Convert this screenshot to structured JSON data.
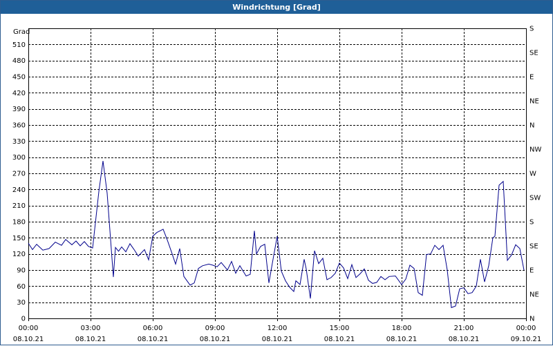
{
  "window": {
    "title": "Windrichtung [Grad]"
  },
  "chart_data": {
    "type": "line",
    "title": "Windrichtung [Grad]",
    "ylabel": "Grad",
    "ylim": [
      0,
      540
    ],
    "y_ticks": [
      0,
      30,
      60,
      90,
      120,
      150,
      180,
      210,
      240,
      270,
      300,
      330,
      360,
      390,
      420,
      450,
      480,
      510
    ],
    "y2_ticks": [
      {
        "value": 0,
        "label": "N"
      },
      {
        "value": 45,
        "label": "NE"
      },
      {
        "value": 90,
        "label": "E"
      },
      {
        "value": 135,
        "label": "SE"
      },
      {
        "value": 180,
        "label": "S"
      },
      {
        "value": 225,
        "label": "SW"
      },
      {
        "value": 270,
        "label": "W"
      },
      {
        "value": 315,
        "label": "NW"
      },
      {
        "value": 360,
        "label": "N"
      },
      {
        "value": 405,
        "label": "NE"
      },
      {
        "value": 450,
        "label": "E"
      },
      {
        "value": 495,
        "label": "SE"
      },
      {
        "value": 540,
        "label": "S"
      }
    ],
    "xlim_hours": [
      0,
      24
    ],
    "x_ticks": [
      {
        "hour": 0,
        "time": "00:00",
        "date": "08.10.21"
      },
      {
        "hour": 3,
        "time": "03:00",
        "date": "08.10.21"
      },
      {
        "hour": 6,
        "time": "06:00",
        "date": "08.10.21"
      },
      {
        "hour": 9,
        "time": "09:00",
        "date": "08.10.21"
      },
      {
        "hour": 12,
        "time": "12:00",
        "date": "08.10.21"
      },
      {
        "hour": 15,
        "time": "15:00",
        "date": "08.10.21"
      },
      {
        "hour": 18,
        "time": "18:00",
        "date": "08.10.21"
      },
      {
        "hour": 21,
        "time": "21:00",
        "date": "08.10.21"
      },
      {
        "hour": 24,
        "time": "00:00",
        "date": "09.10.21"
      }
    ],
    "grid": true,
    "line_color": "#00008b",
    "x": [
      0,
      0.2,
      0.4,
      0.7,
      1,
      1.3,
      1.6,
      1.8,
      2.1,
      2.3,
      2.5,
      2.7,
      2.9,
      3.1,
      3.4,
      3.6,
      3.8,
      4.1,
      4.2,
      4.35,
      4.5,
      4.7,
      4.9,
      5.1,
      5.3,
      5.6,
      5.8,
      6,
      6.2,
      6.5,
      6.7,
      6.9,
      7.1,
      7.3,
      7.5,
      7.8,
      8,
      8.2,
      8.4,
      8.7,
      8.9,
      9.1,
      9.3,
      9.6,
      9.8,
      10,
      10.2,
      10.5,
      10.7,
      10.9,
      11,
      11.2,
      11.4,
      11.6,
      11.8,
      12,
      12.2,
      12.4,
      12.6,
      12.8,
      12.9,
      13.1,
      13.3,
      13.4,
      13.6,
      13.8,
      14,
      14.2,
      14.4,
      14.6,
      14.8,
      15,
      15.2,
      15.4,
      15.6,
      15.8,
      16,
      16.2,
      16.4,
      16.6,
      16.8,
      17,
      17.2,
      17.4,
      17.7,
      18,
      18.2,
      18.4,
      18.6,
      18.8,
      19,
      19.2,
      19.4,
      19.6,
      19.8,
      20,
      20.2,
      20.4,
      20.6,
      20.8,
      21,
      21.2,
      21.4,
      21.6,
      21.8,
      22,
      22.2,
      22.4,
      22.5,
      22.7,
      22.9,
      23.1,
      23.3,
      23.5,
      23.7,
      23.9
    ],
    "values": [
      140,
      128,
      138,
      127,
      130,
      142,
      136,
      147,
      137,
      144,
      135,
      143,
      134,
      131,
      236,
      293,
      233,
      77,
      132,
      125,
      133,
      124,
      139,
      128,
      116,
      128,
      109,
      153,
      160,
      166,
      146,
      124,
      101,
      130,
      78,
      62,
      66,
      93,
      98,
      101,
      99,
      96,
      104,
      90,
      106,
      84,
      98,
      79,
      82,
      163,
      120,
      134,
      138,
      66,
      110,
      153,
      88,
      70,
      58,
      50,
      70,
      63,
      110,
      92,
      37,
      126,
      102,
      112,
      72,
      76,
      84,
      103,
      94,
      74,
      100,
      76,
      83,
      92,
      71,
      65,
      67,
      78,
      72,
      78,
      79,
      63,
      73,
      99,
      93,
      48,
      43,
      119,
      120,
      136,
      128,
      136,
      90,
      20,
      23,
      55,
      57,
      46,
      48,
      60,
      110,
      68,
      98,
      150,
      153,
      248,
      255,
      108,
      118,
      137,
      130,
      90,
      87,
      85,
      86
    ]
  }
}
